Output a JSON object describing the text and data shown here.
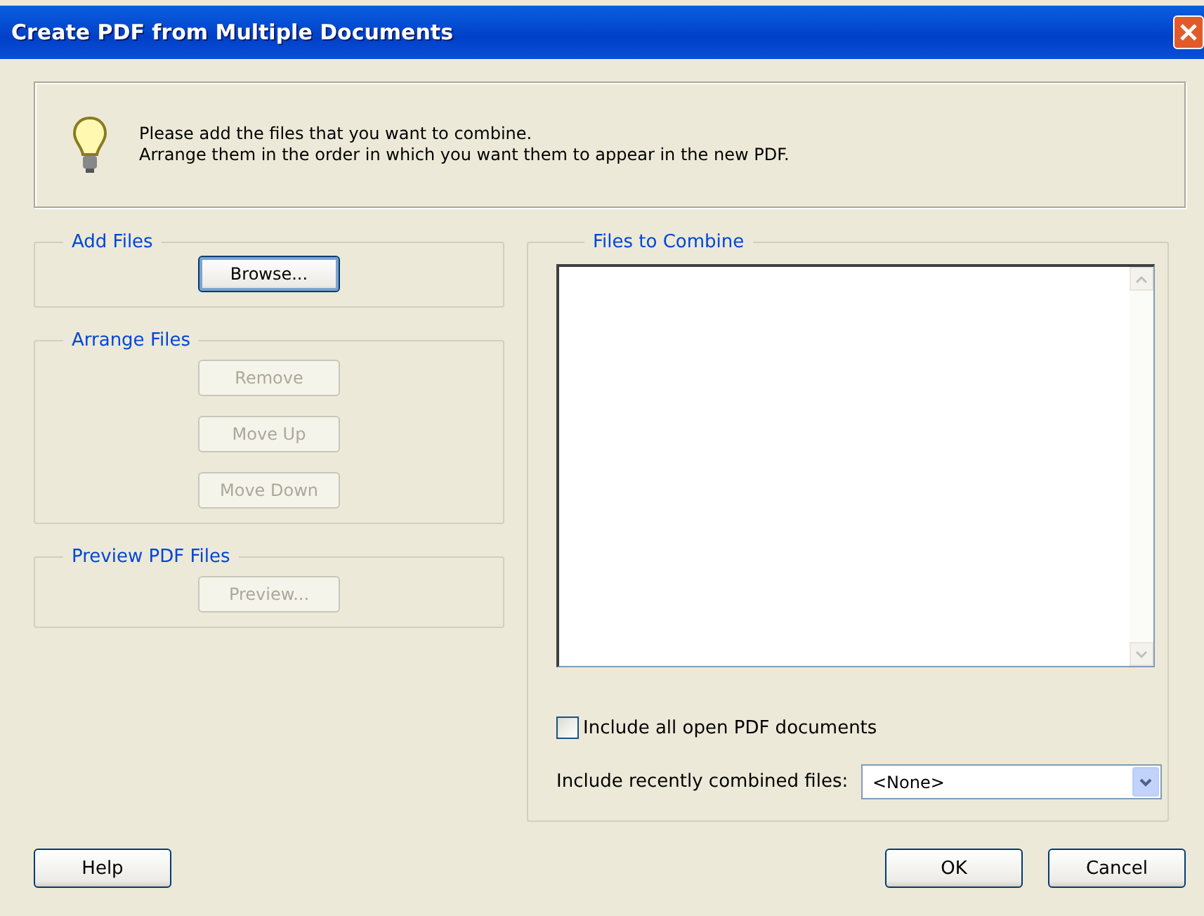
{
  "window": {
    "title": "Create PDF from Multiple Documents"
  },
  "info": {
    "lines": [
      "Please add the files that you want to combine.",
      "Arrange them in the order in which you want them to appear in the new PDF."
    ]
  },
  "groups": [
    {
      "title": "Add Files",
      "buttons": [
        {
          "label": "Browse...",
          "disabled": false,
          "focused": true
        }
      ]
    },
    {
      "title": "Arrange Files",
      "buttons": [
        {
          "label": "Remove",
          "disabled": true,
          "focused": false
        },
        {
          "label": "Move Up",
          "disabled": true,
          "focused": false
        },
        {
          "label": "Move Down",
          "disabled": true,
          "focused": false
        }
      ]
    },
    {
      "title": "Preview PDF Files",
      "buttons": [
        {
          "label": "Preview...",
          "disabled": true,
          "focused": false
        }
      ]
    }
  ],
  "files_to_combine": {
    "title": "Files to Combine",
    "include_open": {
      "label": "Include all open PDF documents",
      "checked": false
    },
    "recent": {
      "label": "Include recently combined files:",
      "value": "<None>"
    }
  },
  "footer": {
    "help": "Help",
    "ok": "OK",
    "cancel": "Cancel"
  }
}
